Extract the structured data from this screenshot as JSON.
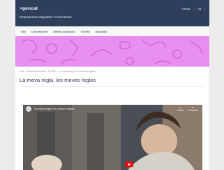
{
  "header": {
    "logo": "+gencat",
    "department": "Departament d'Igualtat i Feminismes",
    "links": [
      "Cercar",
      "|",
      "ca",
      "|"
    ]
  },
  "nav": {
    "items": [
      "Inici",
      "Departament",
      "Àmbits d'actuació",
      "Tràmits",
      "Actualitat"
    ]
  },
  "breadcrumb": "Inici · Àmbits d'actuació · LGTBI+ · Le meva regla, les meves regles",
  "page_title": "La meva regla, les meves regles",
  "video": {
    "title": "La meva regla, les meves regles",
    "actions": [
      "Veure",
      "Compartir"
    ]
  },
  "colors": {
    "header_bg": "#2e3f5c",
    "banner_bg": "#e98ff0",
    "youtube_red": "#ff0000"
  }
}
